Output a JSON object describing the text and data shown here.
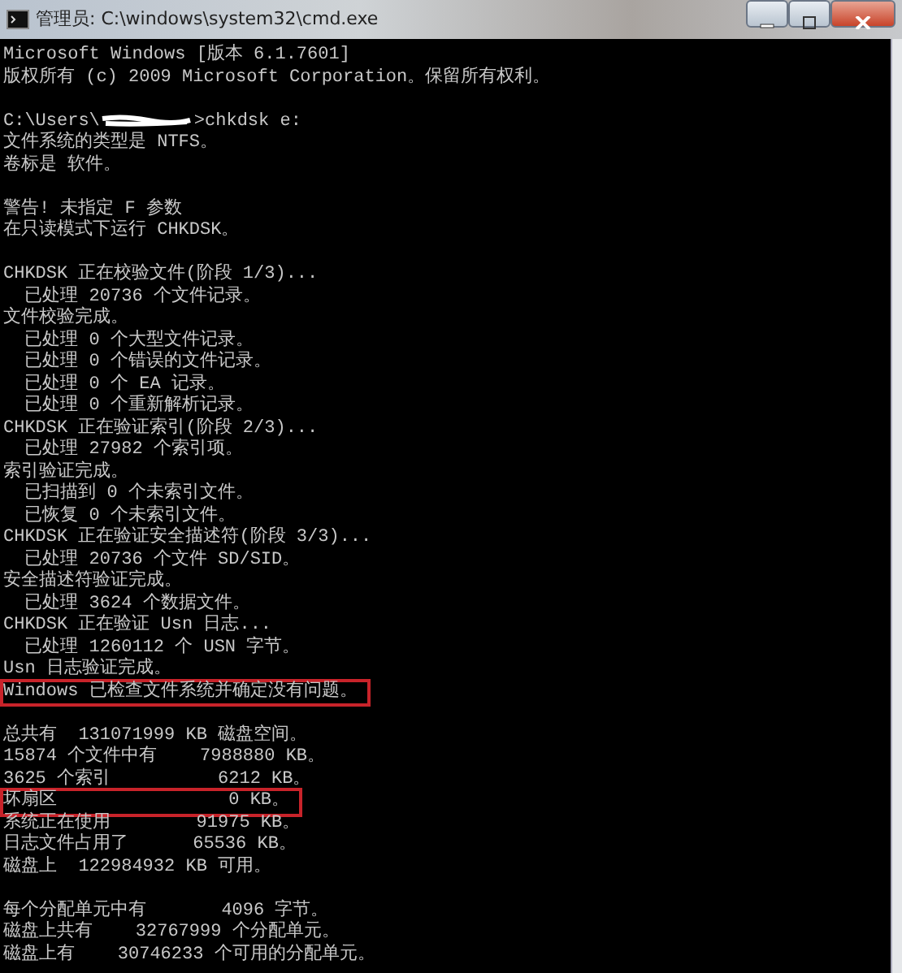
{
  "window": {
    "title": "管理员: C:\\windows\\system32\\cmd.exe"
  },
  "console": {
    "lines": [
      {
        "kind": "text",
        "text": "Microsoft Windows [版本 6.1.7601]",
        "highlighted": false
      },
      {
        "kind": "text",
        "text": "版权所有 (c) 2009 Microsoft Corporation。保留所有权利。",
        "highlighted": false
      },
      {
        "kind": "blank"
      },
      {
        "kind": "prompt",
        "path": "C:\\Users\\",
        "command": ">chkdsk e:",
        "redacted": true,
        "highlighted": false
      },
      {
        "kind": "text",
        "text": "文件系统的类型是 NTFS。",
        "highlighted": false
      },
      {
        "kind": "text",
        "text": "卷标是 软件。",
        "highlighted": false
      },
      {
        "kind": "blank"
      },
      {
        "kind": "text",
        "text": "警告! 未指定 F 参数",
        "highlighted": false
      },
      {
        "kind": "text",
        "text": "在只读模式下运行 CHKDSK。",
        "highlighted": false
      },
      {
        "kind": "blank"
      },
      {
        "kind": "text",
        "text": "CHKDSK 正在校验文件(阶段 1/3)...",
        "highlighted": false
      },
      {
        "kind": "text",
        "text": "  已处理 20736 个文件记录。",
        "highlighted": false
      },
      {
        "kind": "text",
        "text": "文件校验完成。",
        "highlighted": false
      },
      {
        "kind": "text",
        "text": "  已处理 0 个大型文件记录。",
        "highlighted": false
      },
      {
        "kind": "text",
        "text": "  已处理 0 个错误的文件记录。",
        "highlighted": false
      },
      {
        "kind": "text",
        "text": "  已处理 0 个 EA 记录。",
        "highlighted": false
      },
      {
        "kind": "text",
        "text": "  已处理 0 个重新解析记录。",
        "highlighted": false
      },
      {
        "kind": "text",
        "text": "CHKDSK 正在验证索引(阶段 2/3)...",
        "highlighted": false
      },
      {
        "kind": "text",
        "text": "  已处理 27982 个索引项。",
        "highlighted": false
      },
      {
        "kind": "text",
        "text": "索引验证完成。",
        "highlighted": false
      },
      {
        "kind": "text",
        "text": "  已扫描到 0 个未索引文件。",
        "highlighted": false
      },
      {
        "kind": "text",
        "text": "  已恢复 0 个未索引文件。",
        "highlighted": false
      },
      {
        "kind": "text",
        "text": "CHKDSK 正在验证安全描述符(阶段 3/3)...",
        "highlighted": false
      },
      {
        "kind": "text",
        "text": "  已处理 20736 个文件 SD/SID。",
        "highlighted": false
      },
      {
        "kind": "text",
        "text": "安全描述符验证完成。",
        "highlighted": false
      },
      {
        "kind": "text",
        "text": "  已处理 3624 个数据文件。",
        "highlighted": false
      },
      {
        "kind": "text",
        "text": "CHKDSK 正在验证 Usn 日志...",
        "highlighted": false
      },
      {
        "kind": "text",
        "text": "  已处理 1260112 个 USN 字节。",
        "highlighted": false
      },
      {
        "kind": "text",
        "text": "Usn 日志验证完成。",
        "highlighted": false
      },
      {
        "kind": "text",
        "text": "Windows 已检查文件系统并确定没有问题。",
        "highlighted": true
      },
      {
        "kind": "blank"
      },
      {
        "kind": "text",
        "text": "总共有  131071999 KB 磁盘空间。",
        "highlighted": false
      },
      {
        "kind": "text",
        "text": "15874 个文件中有    7988880 KB。",
        "highlighted": false
      },
      {
        "kind": "text",
        "text": "3625 个索引          6212 KB。",
        "highlighted": false
      },
      {
        "kind": "text",
        "text": "坏扇区                0 KB。",
        "highlighted": true
      },
      {
        "kind": "text",
        "text": "系统正在使用        91975 KB。",
        "highlighted": false
      },
      {
        "kind": "text",
        "text": "日志文件占用了      65536 KB。",
        "highlighted": false
      },
      {
        "kind": "text",
        "text": "磁盘上  122984932 KB 可用。",
        "highlighted": false
      },
      {
        "kind": "blank"
      },
      {
        "kind": "text",
        "text": "每个分配单元中有       4096 字节。",
        "highlighted": false
      },
      {
        "kind": "text",
        "text": "磁盘上共有    32767999 个分配单元。",
        "highlighted": false
      },
      {
        "kind": "text",
        "text": "磁盘上有    30746233 个可用的分配单元。",
        "highlighted": false
      }
    ]
  }
}
